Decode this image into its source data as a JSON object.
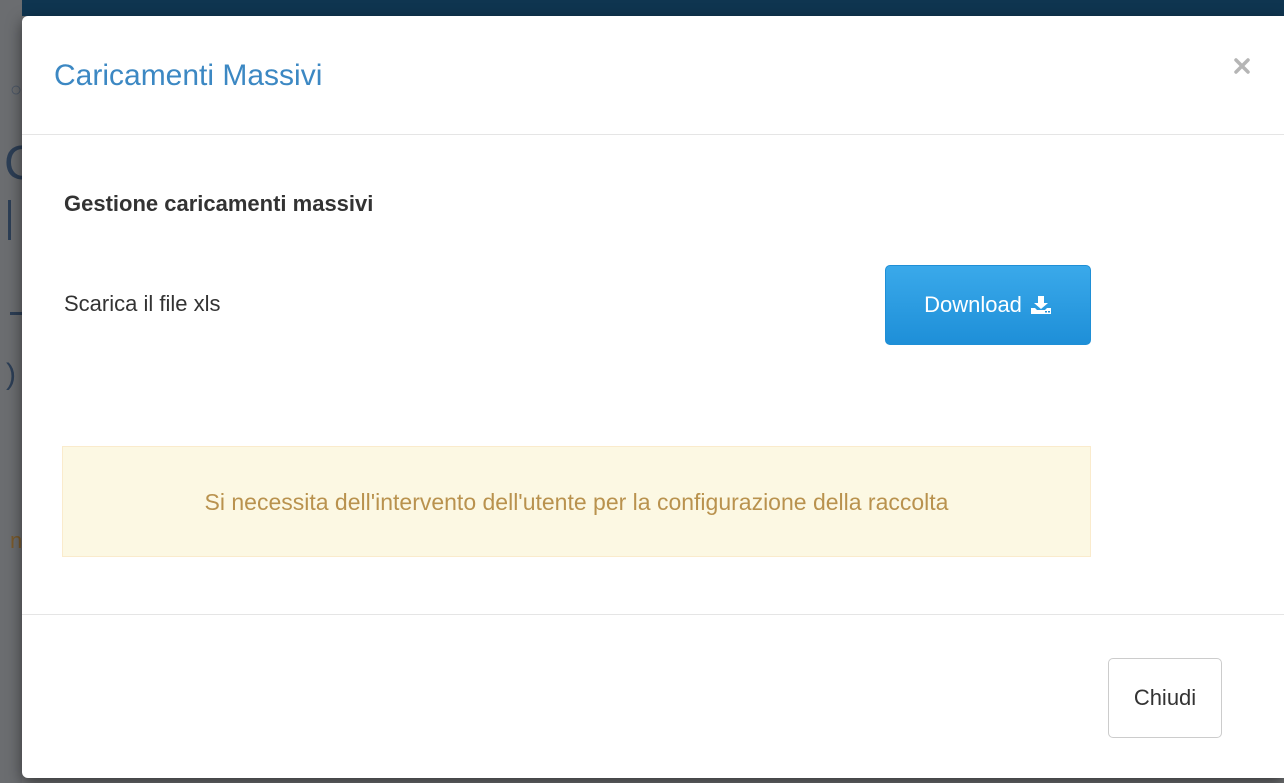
{
  "modal": {
    "title": "Caricamenti Massivi",
    "close_icon": "close-icon"
  },
  "body": {
    "section_heading": "Gestione caricamenti massivi",
    "download_label": "Scarica il file xls",
    "download_button_label": "Download",
    "download_icon": "download-icon",
    "alert_message": "Si necessita dell'intervento dell'utente per la configurazione della raccolta"
  },
  "footer": {
    "close_button_label": "Chiudi"
  },
  "colors": {
    "title": "#3c88c3",
    "primary_button": "#1e8fd8",
    "alert_background": "#fcf8e3",
    "alert_text": "#b9924e",
    "backdrop": "#707274"
  }
}
